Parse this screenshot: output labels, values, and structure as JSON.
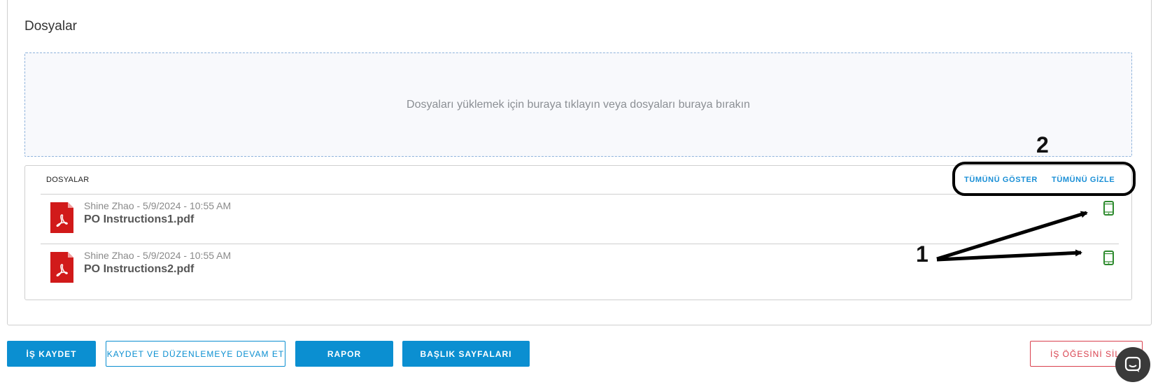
{
  "section": {
    "title": "Dosyalar"
  },
  "dropzone": {
    "text": "Dosyaları yüklemek için buraya tıklayın veya dosyaları buraya bırakın"
  },
  "files_panel": {
    "header_title": "DOSYALAR",
    "show_all_label": "TÜMÜNÜ GÖSTER",
    "hide_all_label": "TÜMÜNÜ GİZLE",
    "files": [
      {
        "meta": "Shine Zhao - 5/9/2024 - 10:55 AM",
        "name": "PO Instructions1.pdf",
        "icon": "pdf-icon",
        "action_icon": "mobile-icon"
      },
      {
        "meta": "Shine Zhao - 5/9/2024 - 10:55 AM",
        "name": "PO Instructions2.pdf",
        "icon": "pdf-icon",
        "action_icon": "mobile-icon"
      }
    ]
  },
  "annotations": {
    "label_1": "1",
    "label_2": "2"
  },
  "footer": {
    "save_label": "İŞ KAYDET",
    "save_continue_label": "KAYDET VE DÜZENLEMEYE DEVAM ET",
    "report_label": "RAPOR",
    "header_pages_label": "BAŞLIK SAYFALARI",
    "delete_label": "İŞ ÖĞESİNİ SİL"
  },
  "colors": {
    "accent": "#0b8fd1",
    "danger": "#d9404d",
    "mobile_icon": "#2e8b2e",
    "pdf_red": "#d11a1a"
  }
}
